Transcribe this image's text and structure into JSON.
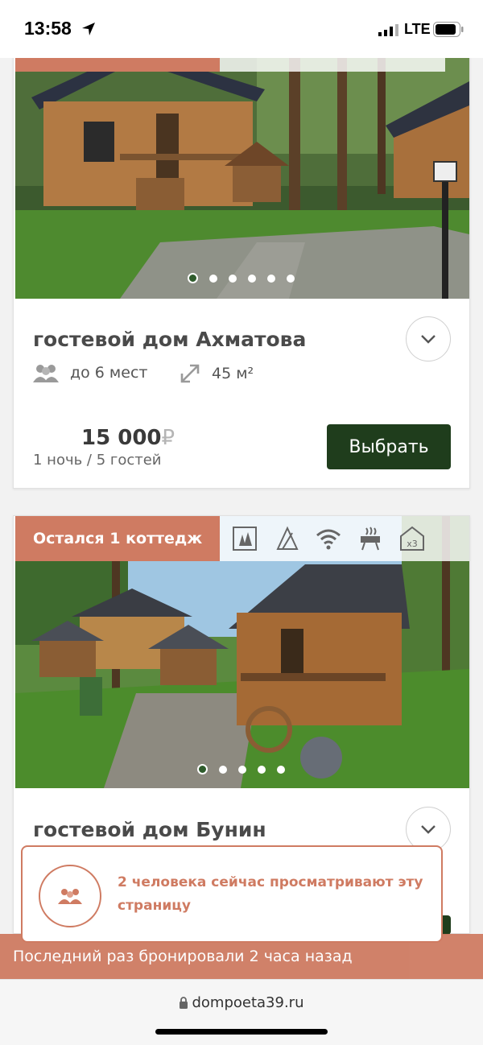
{
  "status_bar": {
    "time": "13:58",
    "network": "LTE"
  },
  "cards": [
    {
      "title": "гостевой дом Ахматова",
      "guests": "до 6 мест",
      "area": "45 м²",
      "price": "15 000",
      "currency": "₽",
      "price_note": "1 ночь / 5 гостей",
      "button": "Выбрать",
      "slides_total": 6,
      "slide_active": 1
    },
    {
      "badge": "Остался 1 коттедж",
      "amenities": [
        "nature-icon",
        "tent-icon",
        "wifi-icon",
        "grill-icon",
        "x3-icon"
      ],
      "amenity_x3": "x3",
      "title": "гостевой дом Бунин",
      "slides_total": 5,
      "slide_active": 1
    }
  ],
  "popup": {
    "message": "2 человека сейчас просматривают эту страницу"
  },
  "banner": {
    "text": "Последний раз бронировали 2 часа назад"
  },
  "browser": {
    "url": "dompoeta39.ru"
  },
  "colors": {
    "accent": "#cf7b62",
    "button": "#1f3d1c"
  }
}
